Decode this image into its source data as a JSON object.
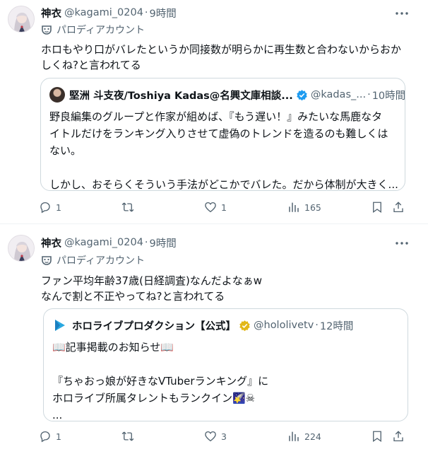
{
  "tweets": [
    {
      "author": {
        "name": "神衣",
        "handle": "@kagami_0204",
        "time": "9時間"
      },
      "label": "パロディアカウント",
      "text": [
        "ホロもやり口がバレたというか同接数が明らかに再生数と合わないからおか",
        "しくね?と言われてる"
      ],
      "quote": {
        "name": "堅洲 斗支夜/Toshiya Kadas@名興文庫相談...",
        "handle": "@kadas_...",
        "time": "10時間",
        "lines": [
          "野良編集のグループと作家が組めば、『もう遅い！』みたいな馬鹿なタ",
          "イトルだけをランキング入りさせて虚偽のトレンドを造るのも難しくは",
          "ない。",
          "",
          "しかし、おそらくそういう手法がどこかでバレた。だから体制が大きく..."
        ]
      },
      "stats": {
        "replies": "1",
        "retweets": "",
        "likes": "1",
        "views": "165"
      }
    },
    {
      "author": {
        "name": "神衣",
        "handle": "@kagami_0204",
        "time": "9時間"
      },
      "label": "パロディアカウント",
      "text": [
        "ファン平均年齢37歳(日経調査)なんだよなぁw",
        "なんで割と不正やってね?と言われてる"
      ],
      "quote": {
        "name": "ホロライブプロダクション【公式】",
        "handle": "@hololivetv",
        "time": "12時間",
        "lines": [
          "📖記事掲載のお知らせ📖",
          "",
          "『ちゃおっ娘が好きなVTuberランキング』に",
          "ホロライブ所属タレントもランクイン🌠☠",
          "..."
        ]
      },
      "stats": {
        "replies": "1",
        "retweets": "",
        "likes": "3",
        "views": "224"
      }
    }
  ],
  "colors": {
    "text": "#0f1419",
    "muted": "#536471",
    "border": "#cfd9de",
    "verified_blue": "#1d9bf0",
    "verified_gold": "#e2b719"
  },
  "icons": [
    "more-icon",
    "parody-mask-icon",
    "verified-badge-icon",
    "gold-verified-badge-icon",
    "reply-icon",
    "retweet-icon",
    "like-icon",
    "views-icon",
    "bookmark-icon",
    "share-icon"
  ]
}
